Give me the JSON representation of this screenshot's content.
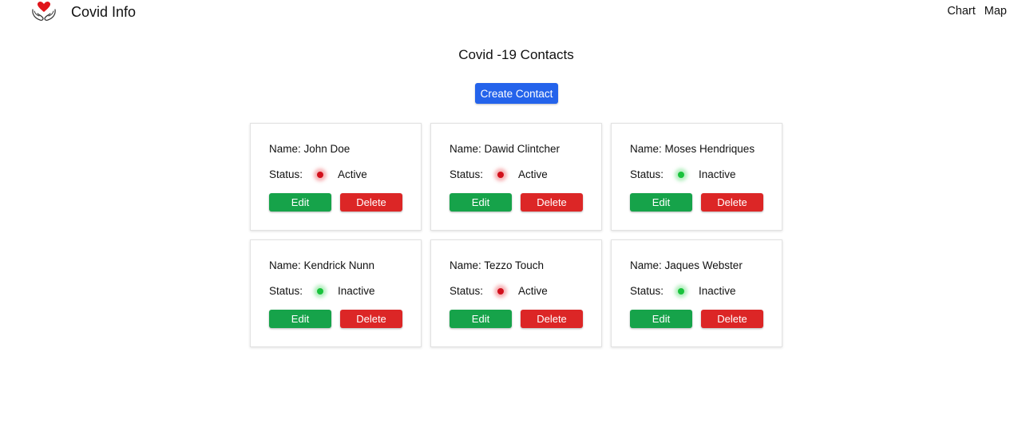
{
  "header": {
    "brand": "Covid Info",
    "logo_icon": "heart-in-hands-icon",
    "nav": [
      {
        "label": "Chart"
      },
      {
        "label": "Map"
      }
    ]
  },
  "main": {
    "title": "Covid -19 Contacts",
    "create_label": "Create Contact",
    "contacts": [
      {
        "name": "Name: John  Doe",
        "status_label": "Status:",
        "status": "Active",
        "edit": "Edit",
        "delete": "Delete"
      },
      {
        "name": "Name: Dawid  Clintcher",
        "status_label": "Status:",
        "status": "Active",
        "edit": "Edit",
        "delete": "Delete"
      },
      {
        "name": "Name: Moses  Hendriques",
        "status_label": "Status:",
        "status": "Inactive",
        "edit": "Edit",
        "delete": "Delete"
      },
      {
        "name": "Name: Kendrick  Nunn",
        "status_label": "Status:",
        "status": "Inactive",
        "edit": "Edit",
        "delete": "Delete"
      },
      {
        "name": "Name: Tezzo  Touch",
        "status_label": "Status:",
        "status": "Active",
        "edit": "Edit",
        "delete": "Delete"
      },
      {
        "name": "Name: Jaques  Webster",
        "status_label": "Status:",
        "status": "Inactive",
        "edit": "Edit",
        "delete": "Delete"
      }
    ]
  },
  "colors": {
    "primary": "#2463eb",
    "edit": "#16a34a",
    "delete": "#dc2626",
    "active_dot": "#d1101c",
    "inactive_dot": "#19c23c"
  }
}
